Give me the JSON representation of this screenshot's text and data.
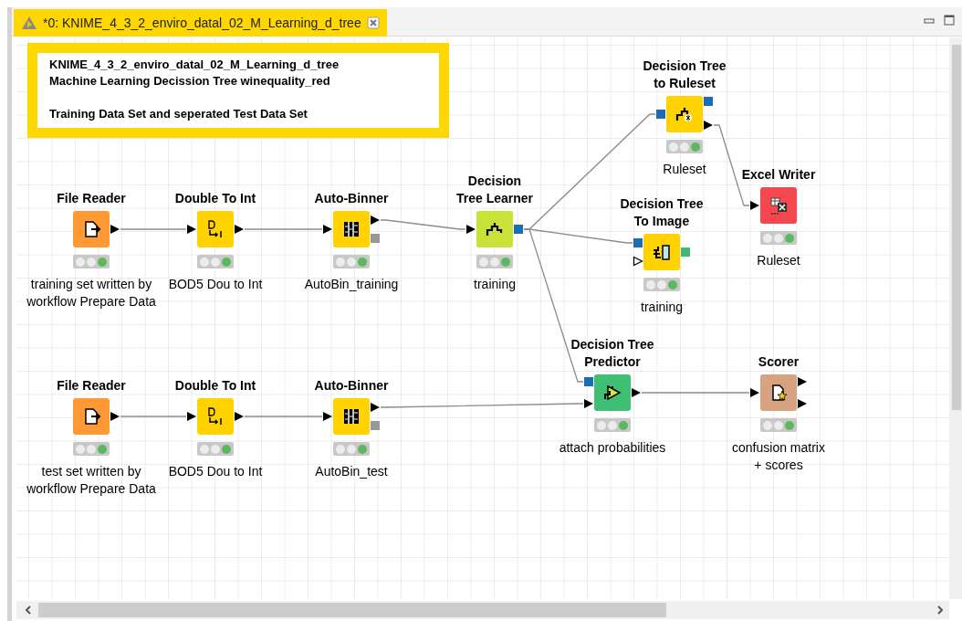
{
  "tab": {
    "title": "*0: KNIME_4_3_2_enviro_datal_02_M_Learning_d_tree",
    "selected": true
  },
  "annotation": {
    "paragraphs": [
      {
        "lines": [
          "KNIME_4_3_2_enviro_datal_02_M_Learning_d_tree",
          "Machine Learning Decission Tree winequality_red"
        ]
      },
      {
        "lines": [
          "Training Data Set and seperated Test Data Set"
        ]
      }
    ]
  },
  "nodes": [
    {
      "kind": "file-reader",
      "title": "File Reader",
      "label": "training set written by\nworkflow Prepare Data",
      "executed": true
    },
    {
      "kind": "double-to-int",
      "title": "Double To Int",
      "label": "BOD5 Dou to Int",
      "executed": true
    },
    {
      "kind": "auto-binner",
      "title": "Auto-Binner",
      "label": "AutoBin_training",
      "executed": true
    },
    {
      "kind": "dt-learner",
      "title": "Decision\nTree Learner",
      "label": "training",
      "executed": true
    },
    {
      "kind": "dt-to-ruleset",
      "title": "Decision Tree\nto Ruleset",
      "label": "Ruleset",
      "executed": true
    },
    {
      "kind": "excel-writer",
      "title": "Excel Writer",
      "label": "Ruleset",
      "executed": true
    },
    {
      "kind": "dt-to-image",
      "title": "Decision Tree\nTo Image",
      "label": "training",
      "executed": true
    },
    {
      "kind": "dt-predictor",
      "title": "Decision Tree\nPredictor",
      "label": "attach probabilities",
      "executed": true
    },
    {
      "kind": "scorer",
      "title": "Scorer",
      "label": "confusion matrix\n+ scores",
      "executed": true
    },
    {
      "kind": "file-reader",
      "title": "File Reader",
      "label": "test set written by\nworkflow Prepare Data",
      "executed": true
    },
    {
      "kind": "double-to-int",
      "title": "Double To Int",
      "label": "BOD5 Dou to Int",
      "executed": true
    },
    {
      "kind": "auto-binner",
      "title": "Auto-Binner",
      "label": "AutoBin_test",
      "executed": true
    }
  ]
}
